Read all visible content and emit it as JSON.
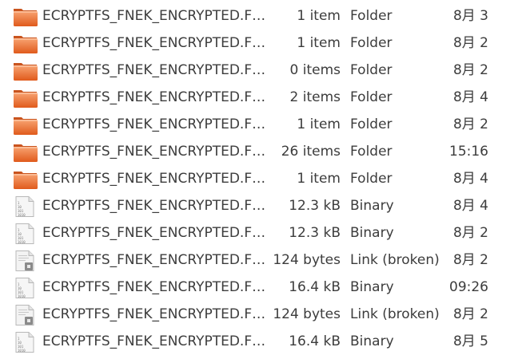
{
  "files": [
    {
      "name": "ECRYPTFS_FNEK_ENCRYPTED.F…",
      "size": "1 item",
      "type": "Folder",
      "modified": "8月 3",
      "icon": "folder-icon"
    },
    {
      "name": "ECRYPTFS_FNEK_ENCRYPTED.F…",
      "size": "1 item",
      "type": "Folder",
      "modified": "8月 2",
      "icon": "folder-icon"
    },
    {
      "name": "ECRYPTFS_FNEK_ENCRYPTED.F…",
      "size": "0 items",
      "type": "Folder",
      "modified": "8月 2",
      "icon": "folder-icon"
    },
    {
      "name": "ECRYPTFS_FNEK_ENCRYPTED.F…",
      "size": "2 items",
      "type": "Folder",
      "modified": "8月 4",
      "icon": "folder-icon"
    },
    {
      "name": "ECRYPTFS_FNEK_ENCRYPTED.F…",
      "size": "1 item",
      "type": "Folder",
      "modified": "8月 2",
      "icon": "folder-icon"
    },
    {
      "name": "ECRYPTFS_FNEK_ENCRYPTED.F…",
      "size": "26 items",
      "type": "Folder",
      "modified": "15:16",
      "icon": "folder-icon"
    },
    {
      "name": "ECRYPTFS_FNEK_ENCRYPTED.F…",
      "size": "1 item",
      "type": "Folder",
      "modified": "8月 4",
      "icon": "folder-icon"
    },
    {
      "name": "ECRYPTFS_FNEK_ENCRYPTED.F…",
      "size": "12.3 kB",
      "type": "Binary",
      "modified": "8月 4",
      "icon": "binary-file-icon"
    },
    {
      "name": "ECRYPTFS_FNEK_ENCRYPTED.F…",
      "size": "12.3 kB",
      "type": "Binary",
      "modified": "8月 2",
      "icon": "binary-file-icon"
    },
    {
      "name": "ECRYPTFS_FNEK_ENCRYPTED.F…",
      "size": "124 bytes",
      "type": "Link (broken)",
      "modified": "8月 2",
      "icon": "broken-link-file-icon"
    },
    {
      "name": "ECRYPTFS_FNEK_ENCRYPTED.F…",
      "size": "16.4 kB",
      "type": "Binary",
      "modified": "09:26",
      "icon": "binary-file-icon"
    },
    {
      "name": "ECRYPTFS_FNEK_ENCRYPTED.F…",
      "size": "124 bytes",
      "type": "Link (broken)",
      "modified": "8月 2",
      "icon": "broken-link-file-icon"
    },
    {
      "name": "ECRYPTFS_FNEK_ENCRYPTED.F…",
      "size": "16.4 kB",
      "type": "Binary",
      "modified": "8月 5",
      "icon": "binary-file-icon"
    }
  ],
  "colors": {
    "folder_top": "#f4a06a",
    "folder_body": "#e86a2a",
    "text": "#3c3c3c"
  }
}
